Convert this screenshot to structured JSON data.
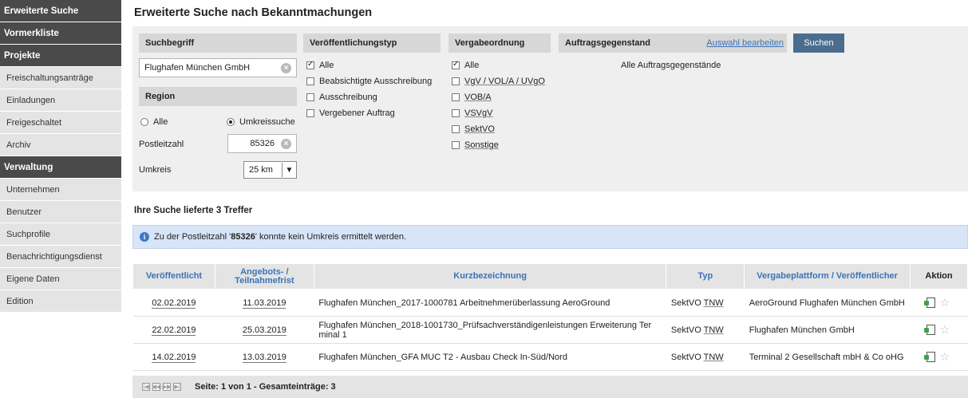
{
  "sidebar": {
    "items": [
      {
        "label": "Erweiterte Suche",
        "style": "dark"
      },
      {
        "label": "Vormerkliste",
        "style": "dark"
      },
      {
        "label": "Projekte",
        "style": "dark"
      },
      {
        "label": "Freischaltungsanträge",
        "style": "light"
      },
      {
        "label": "Einladungen",
        "style": "light"
      },
      {
        "label": "Freigeschaltet",
        "style": "light"
      },
      {
        "label": "Archiv",
        "style": "light"
      },
      {
        "label": "Verwaltung",
        "style": "dark"
      },
      {
        "label": "Unternehmen",
        "style": "light"
      },
      {
        "label": "Benutzer",
        "style": "light"
      },
      {
        "label": "Suchprofile",
        "style": "light"
      },
      {
        "label": "Benachrichtigungsdienst",
        "style": "light"
      },
      {
        "label": "Eigene Daten",
        "style": "light"
      },
      {
        "label": "Edition",
        "style": "light"
      }
    ]
  },
  "page": {
    "title": "Erweiterte Suche nach Bekanntmachungen"
  },
  "search": {
    "suchbegriff_label": "Suchbegriff",
    "suchbegriff_value": "Flughafen München GmbH",
    "region_label": "Region",
    "radio_alle": "Alle",
    "radio_umkreis": "Umkreissuche",
    "plz_label": "Postleitzahl",
    "plz_value": "85326",
    "umkreis_label": "Umkreis",
    "umkreis_value": "25 km",
    "veroeff_label": "Veröffentlichungstyp",
    "veroeff_options": [
      "Alle",
      "Beabsichtigte Ausschreibung",
      "Ausschreibung",
      "Vergebener Auftrag"
    ],
    "vergabe_label": "Vergabeordnung",
    "vergabe_options": [
      "Alle",
      "VgV / VOL/A / UVgO",
      "VOB/A",
      "VSVgV",
      "SektVO",
      "Sonstige"
    ],
    "auftrag_label": "Auftragsgegenstand",
    "auswahl_link": "Auswahl bearbeiten",
    "suchen_button": "Suchen",
    "auftrag_value": "Alle Auftragsgegenstände"
  },
  "results": {
    "title": "Ihre Suche lieferte 3 Treffer",
    "info_prefix": "Zu der Postleitzahl '",
    "info_plz": "85326",
    "info_suffix": "' konnte kein Umkreis ermittelt werden.",
    "headers": [
      "Veröffentlicht",
      "Angebots- / Teilnahmefrist",
      "Kurzbezeichnung",
      "Typ",
      "Vergabeplattform / Veröffentlicher",
      "Aktion"
    ],
    "rows": [
      {
        "veroeff": "02.02.2019",
        "frist": "11.03.2019",
        "kurz": "Flughafen München_2017-1000781 Arbeitnehmerüberlassung AeroGround",
        "typ1": "SektVO",
        "typ2": "TNW",
        "plattform": "AeroGround Flughafen München GmbH"
      },
      {
        "veroeff": "22.02.2019",
        "frist": "25.03.2019",
        "kurz": "Flughafen München_2018-1001730_Prüfsachverständigenleistungen Erweiterung Ter minal 1",
        "typ1": "SektVO",
        "typ2": "TNW",
        "plattform": "Flughafen München GmbH"
      },
      {
        "veroeff": "14.02.2019",
        "frist": "13.03.2019",
        "kurz": "Flughafen München_GFA MUC T2 - Ausbau Check In-Süd/Nord",
        "typ1": "SektVO",
        "typ2": "TNW",
        "plattform": "Terminal 2 Gesellschaft mbH & Co oHG"
      }
    ],
    "pager_text": "Seite: 1 von 1 - Gesamteinträge: 3"
  }
}
